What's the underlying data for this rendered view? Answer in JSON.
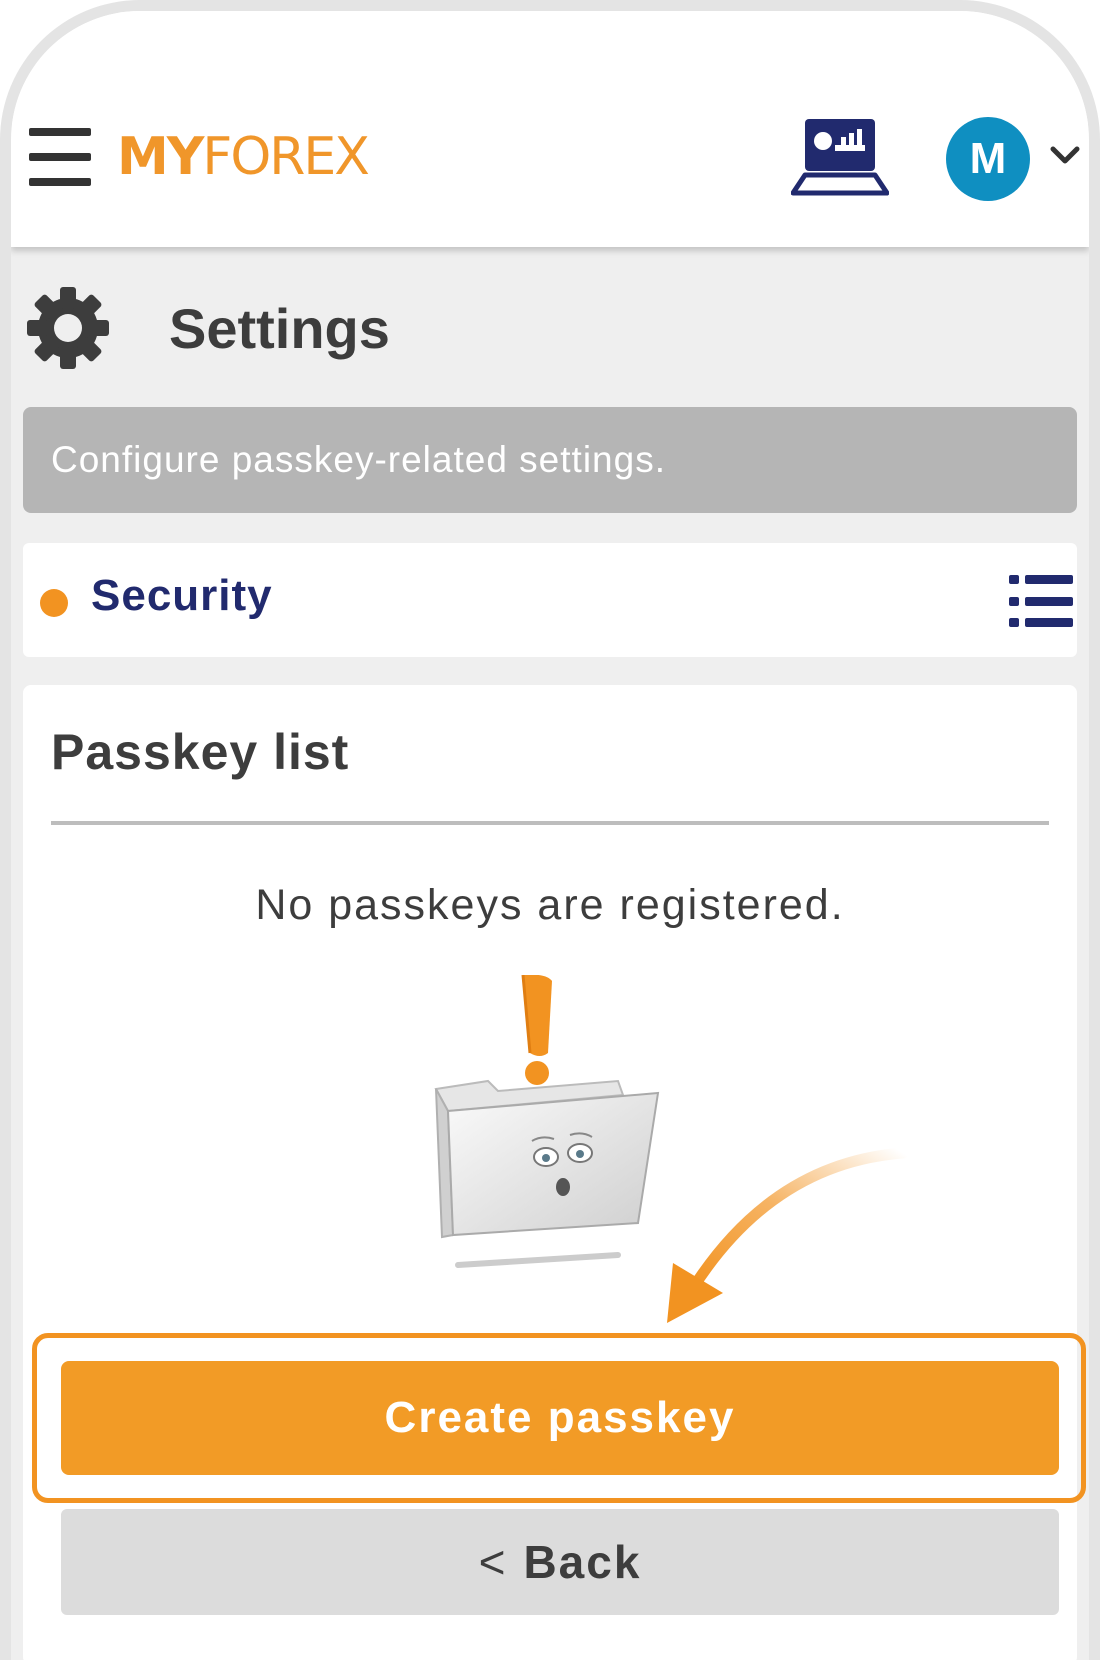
{
  "app": {
    "logo_bold": "MY",
    "logo_rest": "FOREX",
    "avatar_initial": "M",
    "brand_color": "#f29321",
    "avatar_color": "#0f8fc1",
    "icons": [
      "menu-icon",
      "platform-monitor-icon",
      "chevron-down-icon",
      "gear-icon",
      "list-icon",
      "exclamation-icon",
      "folder-illustration",
      "curved-arrow"
    ]
  },
  "page": {
    "title": "Settings",
    "banner": "Configure passkey-related settings."
  },
  "section": {
    "label": "Security"
  },
  "passkeys": {
    "heading": "Passkey list",
    "empty_message": "No passkeys are registered.",
    "create_label": "Create passkey",
    "back_chevron": "<",
    "back_label": "Back"
  }
}
